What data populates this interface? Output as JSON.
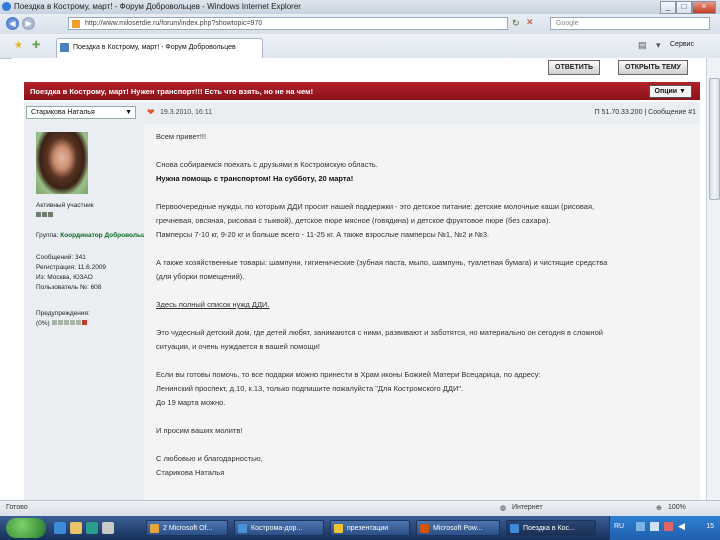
{
  "window": {
    "title": "Поездка в Кострому, март! - Форум Добровольцев - Windows Internet Explorer",
    "controls": [
      "_",
      "□",
      "×"
    ]
  },
  "addressbar": {
    "url": "http://www.miloserdie.ru/forum/index.php?showtopic=970",
    "search_placeholder": "Google"
  },
  "tab": {
    "label": "Поездка в Кострому, март! - Форум Добровольцев"
  },
  "toolbar": {
    "tools_label": "Сервис"
  },
  "post_buttons": {
    "reply": "ОТВЕТИТЬ",
    "new_topic": "ОТКРЫТЬ ТЕМУ"
  },
  "topic": {
    "title": "Поездка в Кострому, март! Нужен транспорт!!! Есть что взять, но не на чем!",
    "options_label": "Опции ▼"
  },
  "post": {
    "author": "Старикова Наталья",
    "date": "19.3.2010, 16:11",
    "number": "#1",
    "post_ref": "Π 51.70.33.200 | Сообщение #1",
    "lines": [
      "Всем привет!!!",
      "",
      "Снова собираемся поехать с друзьями в Костромскую область.",
      "Нужна помощь с транспортом! На субботу, 20 марта!",
      "",
      "Первоочередные нужды, по которым ДДИ просит нашей поддержки - это детское питание: детские молочные каши (рисовая,",
      "гречневая, овсяная, рисовая с тыквой), детское пюре мясное (говядина) и детское фруктовое пюре (без сахара).",
      "Памперсы 7-10 кг, 9-20 кг и больше всего - 11-25 кг. А также взрослые памперсы №1, №2 и №3.",
      "",
      "А также хозяйственные товары: шампуни, гигиенические (зубная паста, мыло, шампунь, туалетная бумага) и чистящие средства",
      "(для уборки помещений).",
      "",
      "Здесь полный список нужд ДДИ.",
      "",
      "Это чудесный детский дом, где детей любят, занимаются с ними, развивают и заботятся, но материально он сегодня в сложной",
      "ситуации, и очень нуждается в вашей помощи!",
      "",
      "Если вы готовы помочь, то все подарки можно принести в Храм иконы Божией Матери Всецарица, по адресу:",
      "Ленинский проспект, д.10, к.13, только подпишите пожалуйста \"Для Костромского ДДИ\".",
      "До 19 марта можно.",
      "",
      "И просим ваших молитв!",
      "",
      "С любовью и благодарностью,",
      "Старикова Наталья"
    ]
  },
  "profile": {
    "rank": "Активный участник",
    "group_label": "Группа:",
    "group_value": "Координатор Добровольцев",
    "posts": "Сообщений: 341",
    "registered": "Регистрация: 11.6.2009",
    "from": "Из: Москва, ЮЗАО",
    "user_no": "Пользователь №: 608",
    "warnings_label": "Предупреждения:",
    "warnings_value": "(0%)"
  },
  "statusbar": {
    "left": "Готово",
    "zone": "Интернет",
    "zoom": "100%"
  },
  "taskbar": {
    "tasks": [
      "2 Microsoft Of...",
      "Кострома-дор...",
      "презентации",
      "Microsoft Pow...",
      "Поездка в Кос..."
    ],
    "lang": "RU",
    "clock": "15"
  },
  "colors": {
    "topic_bar": "#9b1a22",
    "group_text": "#0a6c1a"
  }
}
